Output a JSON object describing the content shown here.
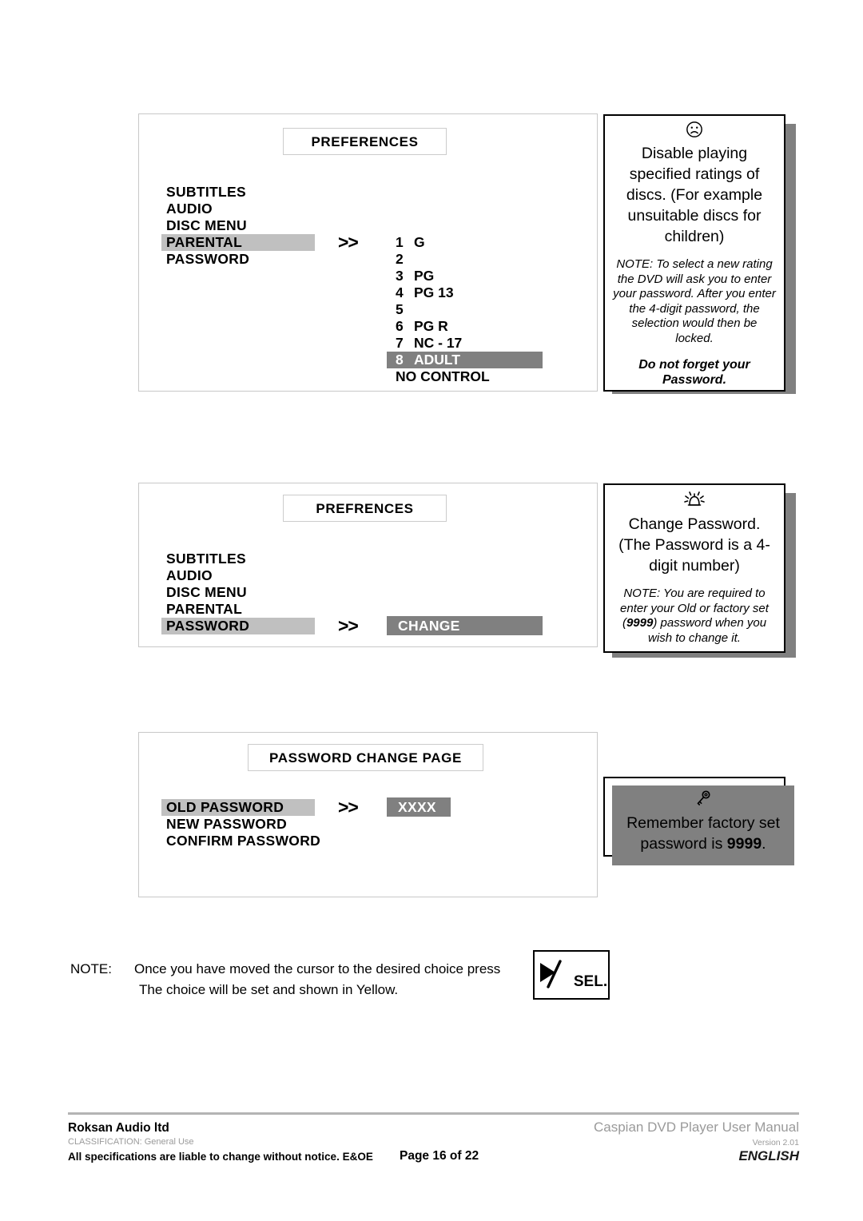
{
  "panels": [
    {
      "name": "parental-panel",
      "title": "PREFERENCES",
      "menu": [
        {
          "label": "SUBTITLES",
          "highlight": "none"
        },
        {
          "label": "AUDIO",
          "highlight": "none"
        },
        {
          "label": "DISC MENU",
          "highlight": "none"
        },
        {
          "label": "PARENTAL",
          "highlight": "light"
        },
        {
          "label": "PASSWORD",
          "highlight": "none"
        }
      ],
      "arrows": ">>",
      "ratings": [
        {
          "num": "1",
          "label": "G",
          "highlight": "none"
        },
        {
          "num": "2",
          "label": "",
          "highlight": "none"
        },
        {
          "num": "3",
          "label": "PG",
          "highlight": "none"
        },
        {
          "num": "4",
          "label": "PG 13",
          "highlight": "none"
        },
        {
          "num": "5",
          "label": "",
          "highlight": "none"
        },
        {
          "num": "6",
          "label": "PG  R",
          "highlight": "none"
        },
        {
          "num": "7",
          "label": "NC - 17",
          "highlight": "none"
        },
        {
          "num": "8",
          "label": "ADULT",
          "highlight": "dark"
        },
        {
          "num": "",
          "label": "NO CONTROL",
          "highlight": "none"
        }
      ]
    },
    {
      "name": "password-panel",
      "title": "PREFRENCES",
      "menu": [
        {
          "label": "SUBTITLES",
          "highlight": "none"
        },
        {
          "label": "AUDIO",
          "highlight": "none"
        },
        {
          "label": "DISC MENU",
          "highlight": "none"
        },
        {
          "label": "PARENTAL",
          "highlight": "none"
        },
        {
          "label": "PASSWORD",
          "highlight": "light"
        }
      ],
      "arrows": ">>",
      "value": "CHANGE"
    },
    {
      "name": "password-change-panel",
      "title": "PASSWORD CHANGE PAGE",
      "menu": [
        {
          "label": "OLD PASSWORD",
          "highlight": "light"
        },
        {
          "label": "NEW PASSWORD",
          "highlight": "none"
        },
        {
          "label": "CONFIRM PASSWORD",
          "highlight": "none"
        }
      ],
      "arrows": ">>",
      "value": "XXXX"
    }
  ],
  "callouts": {
    "parental": {
      "icon": "frowning-face-icon",
      "icon_glyph": "☹",
      "headline": "Disable playing specified ratings of discs. (For example unsuitable discs for children)",
      "note_pre": "NOTE: To select a new rating the DVD will ask you to enter your password. After you enter the 4-digit password, the selection would then be locked.",
      "warning": "Do not forget your Password."
    },
    "password": {
      "icon": "alarm-bell-icon",
      "headline": "Change Password. (The Password is a 4-digit number)",
      "note_pre": "NOTE: You are required to enter your Old or factory set (",
      "note_bold": "9999",
      "note_post": ") password when you wish to change it."
    },
    "factory": {
      "icon": "key-icon",
      "text_pre": "Remember factory set password is ",
      "text_bold": "9999",
      "text_post": "."
    }
  },
  "bottom_note": {
    "lead": "NOTE:",
    "line1": "Once you have moved the cursor to the desired choice press",
    "line2": "The choice will be set and shown in Yellow.",
    "button_label": "SEL.",
    "button_icon": "play-select-icon"
  },
  "footer": {
    "company": "Roksan Audio ltd",
    "classification": "CLASSIFICATION: General Use",
    "spec_note": "All specifications are liable to change without notice. E&OE",
    "page": "Page 16 of 22",
    "manual": "Caspian DVD Player User Manual",
    "version": "Version 2.01",
    "language": "ENGLISH"
  },
  "colors": {
    "highlight_light": "#c0c0c0",
    "highlight_dark": "#808080",
    "panel_border": "#c8c8c8",
    "footer_gray": "#9a9a9a"
  }
}
